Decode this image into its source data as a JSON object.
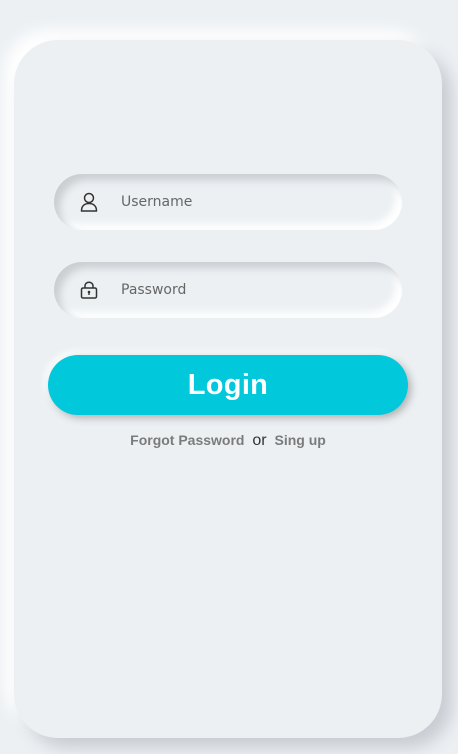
{
  "login_form": {
    "username": {
      "placeholder": "Username",
      "icon": "user-icon"
    },
    "password": {
      "placeholder": "Password",
      "icon": "lock-icon"
    },
    "login_button_label": "Login",
    "forgot_password_label": "Forgot Password",
    "separator_label": "or",
    "signup_label": "Sing up"
  },
  "colors": {
    "background": "#ecf0f3",
    "accent": "#02c8dc",
    "link": "#7b7b7b"
  }
}
